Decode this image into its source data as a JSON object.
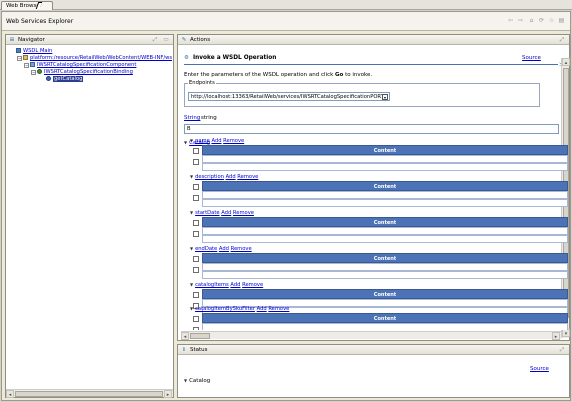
{
  "tab": {
    "label": "Web Browser"
  },
  "window": {
    "title": "Web Services Explorer"
  },
  "navigator": {
    "title": "Navigator",
    "tree": [
      {
        "label": "WSDL Main",
        "level": 0
      },
      {
        "label": "platform:/resource/RetailWeb/WebContent/WEB-INF/ws",
        "level": 1
      },
      {
        "label": "IWSRTCatalogSpecificationComponent",
        "level": 2
      },
      {
        "label": "IWSRTCatalogSpecificationBinding",
        "level": 3
      },
      {
        "label": "getCatalog",
        "level": 4,
        "selected": true
      }
    ]
  },
  "actions": {
    "title": "Actions",
    "heading": "Invoke a WSDL Operation",
    "source_link": "Source",
    "intro": "Enter the parameters of the WSDL operation and click Go to invoke.",
    "endpoints_label": "Endpoints",
    "endpoint_value": "http://localhost:13363/RetailWeb/services/IWSRTCatalogSpecificationPORT",
    "string_link": "String",
    "string_type": "string",
    "input_value": "B",
    "catalog_label": "Catalog",
    "add_label": "Add",
    "remove_label": "Remove",
    "content_label": "Content",
    "fields": [
      "name",
      "description",
      "startDate",
      "endDate",
      "catalogItems",
      "catalogItemBySkuFilter"
    ]
  },
  "status": {
    "title": "Status",
    "source_link": "Source",
    "catalog_label": "Catalog"
  },
  "colors": {
    "accent": "#4d73b7",
    "link": "#0000cc",
    "selection": "#2c3f8f"
  }
}
